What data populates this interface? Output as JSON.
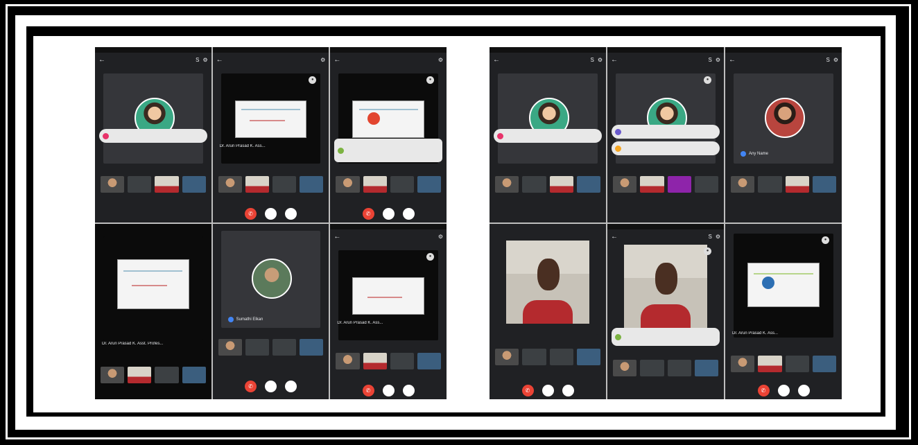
{
  "icons": {
    "back": "←",
    "switch_camera": "S",
    "settings": "⚙",
    "end_call": "✆",
    "mic": "🎤",
    "camera": "◉",
    "pin": "●"
  },
  "colors": {
    "background": "#202124",
    "end_call": "#ea4335",
    "accent": "#4285f4"
  },
  "left": {
    "panels": [
      {
        "caption": "",
        "name": "",
        "toast": ""
      },
      {
        "caption": "Dr. Arun Prasad K. Ass...",
        "name": "",
        "toast": ""
      },
      {
        "caption": "",
        "name": "",
        "toast": ""
      },
      {
        "caption": "Dr. Arun Prasad K. Asst. Profes...",
        "name": "",
        "toast": ""
      },
      {
        "caption": "",
        "name": "Sumathi Elkan",
        "toast": ""
      },
      {
        "caption": "Dr. Arun Prasad K. Ass...",
        "name": "",
        "toast": ""
      }
    ]
  },
  "right": {
    "panels": [
      {
        "caption": "",
        "name": "",
        "toast": ""
      },
      {
        "caption": "",
        "name": "",
        "toast": ""
      },
      {
        "caption": "",
        "name": "Any Name",
        "toast": ""
      },
      {
        "caption": "",
        "name": "",
        "toast": ""
      },
      {
        "caption": "",
        "name": "",
        "toast": ""
      },
      {
        "caption": "Dr. Arun Prasad K. Ass...",
        "name": "",
        "toast": ""
      }
    ]
  }
}
